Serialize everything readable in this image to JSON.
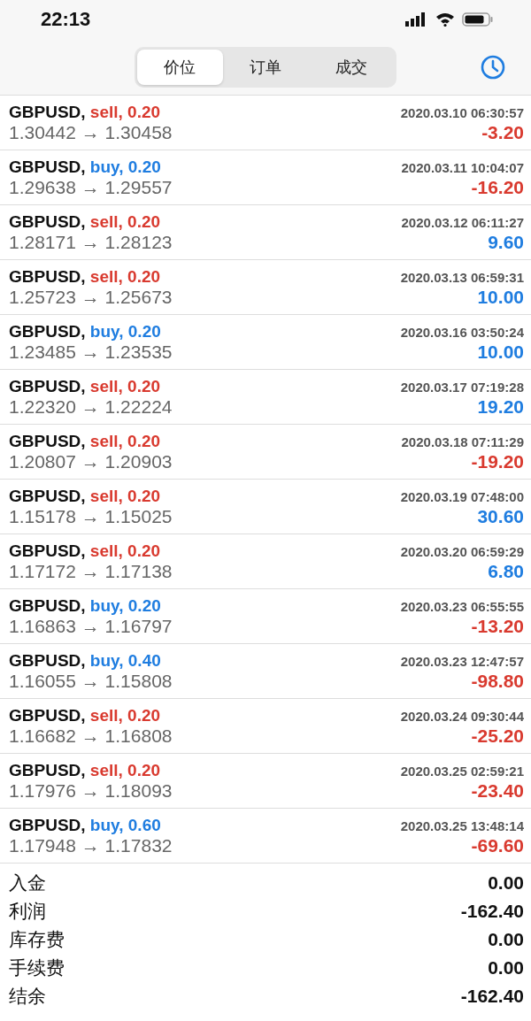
{
  "status_bar": {
    "time": "22:13"
  },
  "tabs": [
    {
      "label": "价位",
      "selected": true
    },
    {
      "label": "订单",
      "selected": false
    },
    {
      "label": "成交",
      "selected": false
    }
  ],
  "trades": [
    {
      "symbol": "GBPUSD,",
      "kind": "sell",
      "side": "sell, 0.20",
      "time": "2020.03.10 06:30:57",
      "prices": "1.30442 → 1.30458",
      "profit": "-3.20",
      "color": "#d93a2f"
    },
    {
      "symbol": "GBPUSD,",
      "kind": "buy",
      "side": "buy, 0.20",
      "time": "2020.03.11 10:04:07",
      "prices": "1.29638 → 1.29557",
      "profit": "-16.20",
      "color": "#d93a2f"
    },
    {
      "symbol": "GBPUSD,",
      "kind": "sell",
      "side": "sell, 0.20",
      "time": "2020.03.12 06:11:27",
      "prices": "1.28171 → 1.28123",
      "profit": "9.60",
      "color": "#1f7de0"
    },
    {
      "symbol": "GBPUSD,",
      "kind": "sell",
      "side": "sell, 0.20",
      "time": "2020.03.13 06:59:31",
      "prices": "1.25723 → 1.25673",
      "profit": "10.00",
      "color": "#1f7de0"
    },
    {
      "symbol": "GBPUSD,",
      "kind": "buy",
      "side": "buy, 0.20",
      "time": "2020.03.16 03:50:24",
      "prices": "1.23485 → 1.23535",
      "profit": "10.00",
      "color": "#1f7de0"
    },
    {
      "symbol": "GBPUSD,",
      "kind": "sell",
      "side": "sell, 0.20",
      "time": "2020.03.17 07:19:28",
      "prices": "1.22320 → 1.22224",
      "profit": "19.20",
      "color": "#1f7de0"
    },
    {
      "symbol": "GBPUSD,",
      "kind": "sell",
      "side": "sell, 0.20",
      "time": "2020.03.18 07:11:29",
      "prices": "1.20807 → 1.20903",
      "profit": "-19.20",
      "color": "#d93a2f"
    },
    {
      "symbol": "GBPUSD,",
      "kind": "sell",
      "side": "sell, 0.20",
      "time": "2020.03.19 07:48:00",
      "prices": "1.15178 → 1.15025",
      "profit": "30.60",
      "color": "#1f7de0"
    },
    {
      "symbol": "GBPUSD,",
      "kind": "sell",
      "side": "sell, 0.20",
      "time": "2020.03.20 06:59:29",
      "prices": "1.17172 → 1.17138",
      "profit": "6.80",
      "color": "#1f7de0"
    },
    {
      "symbol": "GBPUSD,",
      "kind": "buy",
      "side": "buy, 0.20",
      "time": "2020.03.23 06:55:55",
      "prices": "1.16863 → 1.16797",
      "profit": "-13.20",
      "color": "#d93a2f"
    },
    {
      "symbol": "GBPUSD,",
      "kind": "buy",
      "side": "buy, 0.40",
      "time": "2020.03.23 12:47:57",
      "prices": "1.16055 → 1.15808",
      "profit": "-98.80",
      "color": "#d93a2f"
    },
    {
      "symbol": "GBPUSD,",
      "kind": "sell",
      "side": "sell, 0.20",
      "time": "2020.03.24 09:30:44",
      "prices": "1.16682 → 1.16808",
      "profit": "-25.20",
      "color": "#d93a2f"
    },
    {
      "symbol": "GBPUSD,",
      "kind": "sell",
      "side": "sell, 0.20",
      "time": "2020.03.25 02:59:21",
      "prices": "1.17976 → 1.18093",
      "profit": "-23.40",
      "color": "#d93a2f"
    },
    {
      "symbol": "GBPUSD,",
      "kind": "buy",
      "side": "buy, 0.60",
      "time": "2020.03.25 13:48:14",
      "prices": "1.17948 → 1.17832",
      "profit": "-69.60",
      "color": "#d93a2f"
    }
  ],
  "summary": [
    {
      "label": "入金",
      "value": "0.00"
    },
    {
      "label": "利润",
      "value": "-162.40"
    },
    {
      "label": "库存费",
      "value": "0.00"
    },
    {
      "label": "手续费",
      "value": "0.00"
    },
    {
      "label": "结余",
      "value": "-162.40"
    }
  ]
}
